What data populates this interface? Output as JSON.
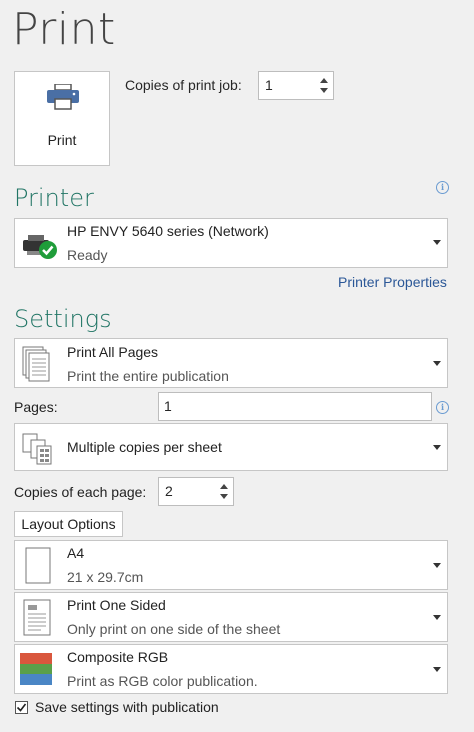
{
  "title": "Print",
  "print_button": {
    "label": "Print",
    "icon": "printer-icon"
  },
  "copies_job": {
    "label": "Copies of print job:",
    "value": "1"
  },
  "printer_section": {
    "heading": "Printer",
    "selected": {
      "name": "HP ENVY 5640 series (Network)",
      "status": "Ready",
      "icon": "printer-ready-icon"
    },
    "properties_link": "Printer Properties"
  },
  "settings_section": {
    "heading": "Settings",
    "print_range": {
      "main": "Print All Pages",
      "sub": "Print the entire publication"
    },
    "pages": {
      "label": "Pages:",
      "value": "1"
    },
    "layout": {
      "main": "Multiple copies per sheet"
    },
    "copies_each": {
      "label": "Copies of each page:",
      "value": "2"
    },
    "layout_options_button": "Layout Options",
    "paper": {
      "main": "A4",
      "sub": "21 x 29.7cm"
    },
    "sides": {
      "main": "Print One Sided",
      "sub": "Only print on one side of the sheet"
    },
    "color": {
      "main": "Composite RGB",
      "sub": "Print as RGB color publication."
    },
    "save_settings": {
      "label": "Save settings with publication",
      "checked": true
    }
  },
  "colors": {
    "accent": "#217565",
    "link": "#2b5797",
    "background": "#f0f0f0"
  }
}
